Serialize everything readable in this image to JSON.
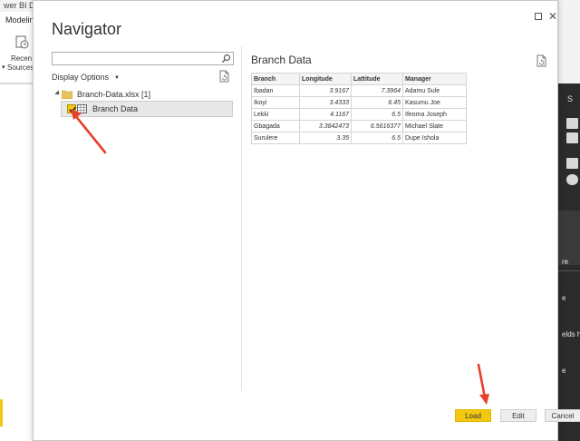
{
  "background": {
    "window_title": "wer BI Desktop",
    "ribbon_tab": "Modelin",
    "recent_sources_line1": "Recen",
    "recent_sources_line2": "Sources",
    "right_panel": {
      "letter": "S",
      "text_1": "re",
      "text_2": "e",
      "text_3": "elds h",
      "text_4": "e"
    }
  },
  "dialog": {
    "title": "Navigator",
    "search": {
      "placeholder": "",
      "value": ""
    },
    "display_options_label": "Display Options",
    "tree": {
      "root_label": "Branch-Data.xlsx [1]",
      "item_label": "Branch Data",
      "item_checked": true
    },
    "preview": {
      "title": "Branch Data",
      "columns": [
        "Branch",
        "Longitude",
        "Lattitude",
        "Manager"
      ],
      "rows": [
        [
          "Ibadan",
          "3.9167",
          "7.3964",
          "Adamu Sule"
        ],
        [
          "Ikoyi",
          "3.4333",
          "6.45",
          "Kasumu Joe"
        ],
        [
          "Lekki",
          "4.1167",
          "6.5",
          "Ifeoma Joseph"
        ],
        [
          "Gbagada",
          "3.3842473",
          "6.5616377",
          "Michael Slate"
        ],
        [
          "Surulere",
          "3.35",
          "6.5",
          "Dupe Ishola"
        ]
      ]
    },
    "buttons": {
      "load": "Load",
      "edit": "Edit",
      "cancel": "Cancel"
    },
    "colors": {
      "accent_yellow": "#f2c811",
      "annotation_arrow": "#e8402a"
    }
  }
}
